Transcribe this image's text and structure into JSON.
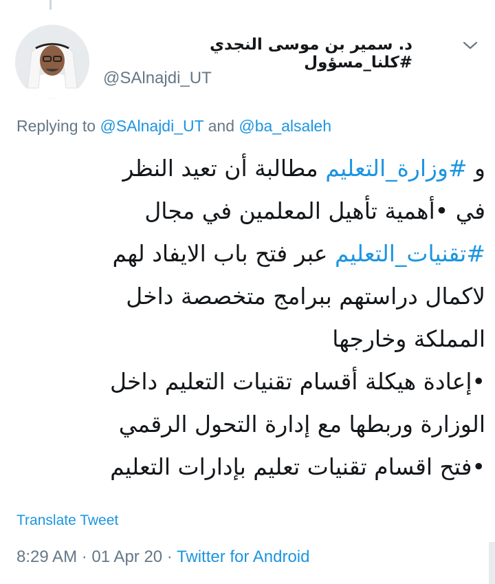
{
  "author": {
    "display_name": "د. سمير بن موسى النجدي #كلنا_مسؤول",
    "handle": "@SAlnajdi_UT"
  },
  "reply": {
    "prefix": "Replying to ",
    "mention1": "@SAlnajdi_UT",
    "connector": " and ",
    "mention2": "@ba_alsaleh"
  },
  "tweet": {
    "l1_pre": "و ",
    "l1_tag": "#وزارة_التعليم",
    "l1_post": " مطالبة أن تعيد النظر",
    "l2": "في •أهمية تأهيل المعلمين في مجال",
    "l3_tag": "#تقنيات_التعليم",
    "l3_post": " عبر فتح باب الايفاد لهم",
    "l4": "لاكمال دراستهم ببرامج متخصصة داخل",
    "l5": "المملكة وخارجها",
    "l6": "•إعادة هيكلة أقسام تقنيات التعليم داخل",
    "l7": "الوزارة وربطها مع إدارة التحول الرقمي",
    "l8": "•فتح اقسام تقنيات تعليم بإدارات التعليم"
  },
  "translate_label": "Translate Tweet",
  "meta": {
    "time": "8:29 AM",
    "sep1": " · ",
    "date": "01 Apr 20",
    "sep2": " · ",
    "source": "Twitter for Android"
  },
  "colors": {
    "link": "#1b95e0",
    "secondary_text": "#657786",
    "primary_text": "#14171a"
  },
  "icons": [
    "chevron-down-icon"
  ]
}
